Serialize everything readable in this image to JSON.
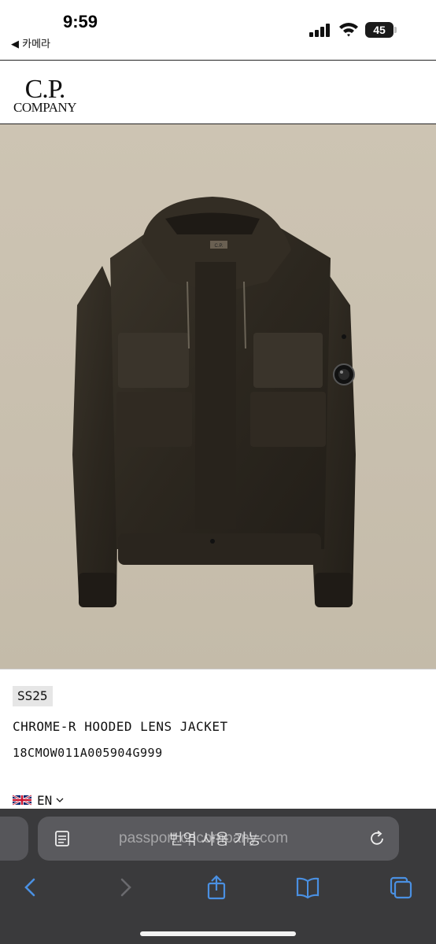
{
  "status_bar": {
    "time": "9:59",
    "back_app": "◀ 카메라",
    "battery_level": "45"
  },
  "site": {
    "logo_line1": "C.P.",
    "logo_line2": "COMPANY"
  },
  "product": {
    "season": "SS25",
    "name": "CHROME-R HOODED LENS JACKET",
    "code": "18CMOW011A005904G999",
    "language": "EN",
    "sleeve_badge_text": "C.P."
  },
  "browser": {
    "url": "passport.cpcompany.com",
    "translate_hint": "번역 사용 가능"
  },
  "colors": {
    "hero_bg": "#cbc2b1",
    "jacket": "#2f2a22",
    "browser_bg": "#3a3a3c",
    "accent": "#4a90e2"
  }
}
